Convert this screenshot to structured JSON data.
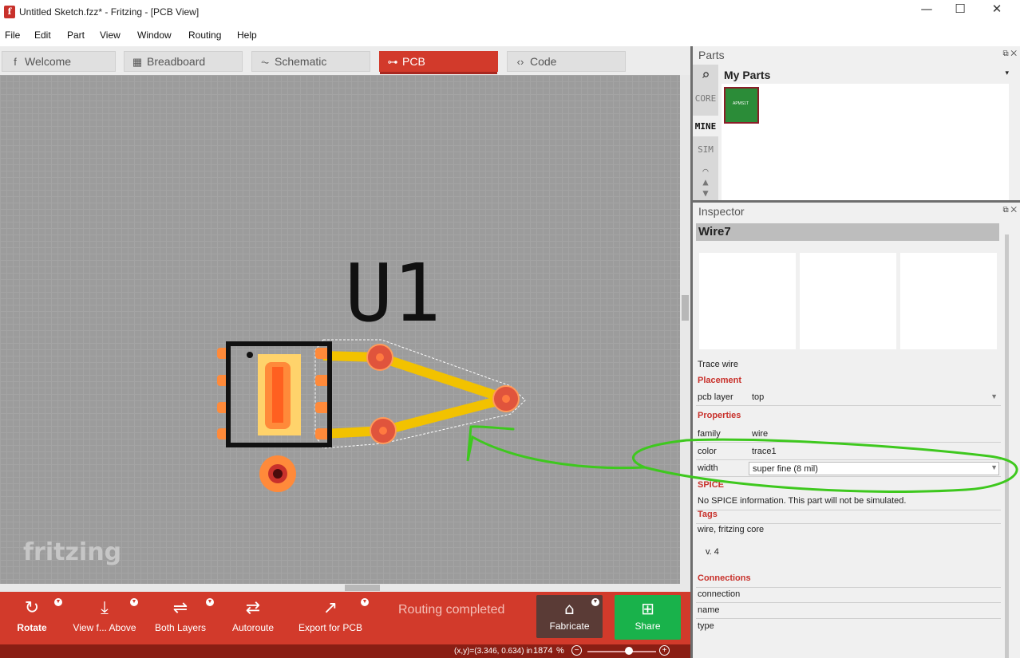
{
  "window": {
    "title": "Untitled Sketch.fzz* - Fritzing - [PCB View]",
    "app_icon": "f",
    "minimize": "—",
    "maximize": "☐",
    "close": "✕"
  },
  "menu": [
    "File",
    "Edit",
    "Part",
    "View",
    "Window",
    "Routing",
    "Help"
  ],
  "tabs": [
    {
      "label": "Welcome",
      "icon": "fritzing-f-icon",
      "glyph": "f"
    },
    {
      "label": "Breadboard",
      "icon": "breadboard-icon",
      "glyph": "▦"
    },
    {
      "label": "Schematic",
      "icon": "schematic-icon",
      "glyph": "⏦"
    },
    {
      "label": "PCB",
      "icon": "pcb-icon",
      "glyph": "⊶"
    },
    {
      "label": "Code",
      "icon": "code-icon",
      "glyph": "‹›"
    }
  ],
  "canvas": {
    "part_label": "U1",
    "watermark": "fritzing"
  },
  "toolbar": {
    "rotate": "Rotate",
    "view_from": "View f... Above",
    "layers": "Both Layers",
    "autoroute": "Autoroute",
    "export": "Export for PCB",
    "status": "Routing completed",
    "fabricate": "Fabricate",
    "share": "Share"
  },
  "statusbar": {
    "coords": "(x,y)=(3.346, 0.634) in",
    "zoom": "1874",
    "zoom_unit": "%",
    "zoom_out": "−",
    "zoom_in": "+"
  },
  "parts": {
    "title": "Parts",
    "bins": [
      "CORE",
      "MINE",
      "SIM"
    ],
    "active_bin": "MINE",
    "bin_title": "My Parts",
    "part_text": "APMS1T"
  },
  "inspector": {
    "title": "Inspector",
    "item_title": "Wire7",
    "description": "Trace wire",
    "placement_label": "Placement",
    "pcb_layer_key": "pcb layer",
    "pcb_layer_value": "top",
    "properties_label": "Properties",
    "family_key": "family",
    "family_value": "wire",
    "color_key": "color",
    "color_value": "trace1",
    "width_key": "width",
    "width_value": "super fine (8 mil)",
    "spice_label": "SPICE",
    "spice_text": "No SPICE information. This part will not be simulated.",
    "tags_label": "Tags",
    "tags_value": "wire, fritzing core",
    "version": "v. 4",
    "connections_label": "Connections",
    "connections": [
      "connection",
      "name",
      "type"
    ]
  },
  "colors": {
    "accent": "#d23a2b",
    "share": "#19b24b",
    "trace": "#f2c200",
    "annotation": "#3ec81e"
  }
}
